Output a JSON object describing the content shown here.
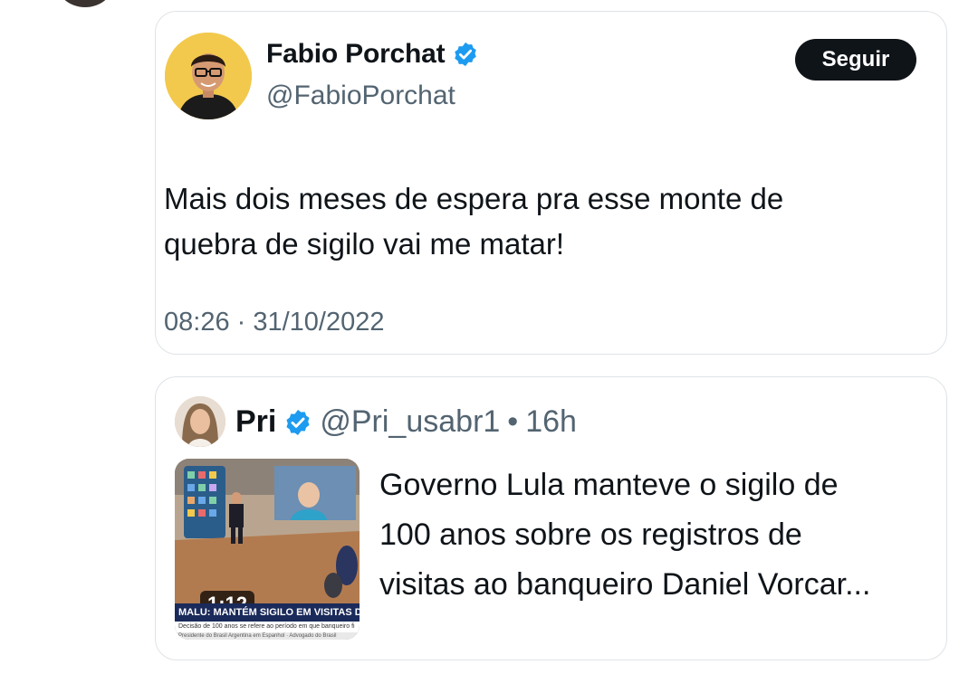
{
  "tweet": {
    "author_name": "Fabio Porchat",
    "author_handle": "@FabioPorchat",
    "follow_label": "Seguir",
    "text_lines": [
      "Mais dois meses de espera pra esse monte de",
      "quebra de sigilo vai me matar!"
    ],
    "timestamp": "08:26 · 31/10/2022",
    "verified_icon": "verified-badge-icon",
    "avatar_bg_color": "#f2c94c"
  },
  "quote": {
    "author_name": "Pri",
    "author_handle": "@Pri_usabr1",
    "separator": "•",
    "age": "16h",
    "text_lines": [
      "Governo Lula manteve o sigilo de",
      "100 anos sobre os registros de",
      "visitas ao banqueiro Daniel Vorcar..."
    ],
    "media": {
      "duration": "1:12",
      "ticker": "MALU: MANTÉM SIGILO EM VISITAS D",
      "ticker_sub": "Decisão de 100 anos se refere ao período em que banqueiro fi",
      "ticker_sub2": "Presidente do Brasil Argentina em Espanhol · Advogado do Brasil"
    }
  },
  "colors": {
    "verified_blue": "#1d9bf0",
    "text_primary": "#0f1419",
    "text_secondary": "#536471",
    "follow_button_bg": "#0f1419",
    "card_border": "#dfe3e7"
  }
}
